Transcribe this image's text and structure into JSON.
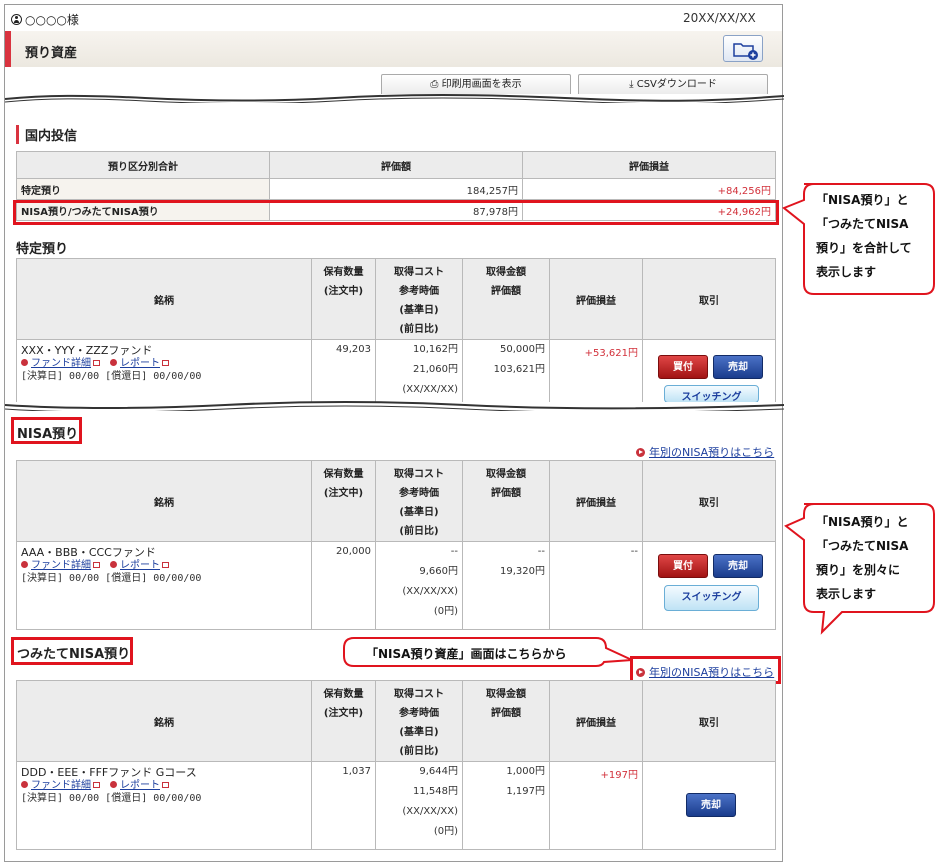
{
  "header": {
    "user": "○○○○様",
    "date": "20XX/XX/XX",
    "title": "預り資産",
    "print_button": "印刷用画面を表示",
    "csv_button": "CSVダウンロード"
  },
  "domestic": {
    "heading": "国内投信",
    "summary_headers": [
      "預り区分別合計",
      "評価額",
      "評価損益"
    ],
    "summary_rows": [
      {
        "label": "特定預り",
        "value": "184,257円",
        "pl": "+84,256円"
      },
      {
        "label": "NISA預り/つみたてNISA預り",
        "value": "87,978円",
        "pl": "+24,962円"
      }
    ]
  },
  "holding_headers": {
    "name": "銘柄",
    "qty": [
      "保有数量",
      "(注文中)"
    ],
    "cost": [
      "取得コスト",
      "参考時価",
      "(基準日)",
      "(前日比)"
    ],
    "amount": [
      "取得金額",
      "評価額"
    ],
    "pl": "評価損益",
    "trade": "取引"
  },
  "tokutei": {
    "heading": "特定預り",
    "fund": "XXX・YYY・ZZZファンド",
    "link_detail": "ファンド詳細",
    "link_report": "レポート",
    "dates": "[決算日] 00/00 [償還日] 00/00/00",
    "qty": "49,203",
    "cost": [
      "10,162円",
      "21,060円",
      "(XX/XX/XX)"
    ],
    "amount": [
      "50,000円",
      "103,621円"
    ],
    "pl": "+53,621円",
    "buy": "買付",
    "sell": "売却",
    "switch": "スイッチング"
  },
  "nisa": {
    "heading": "NISA預り",
    "yearly_link": "年別のNISA預りはこちら",
    "fund": "AAA・BBB・CCCファンド",
    "link_detail": "ファンド詳細",
    "link_report": "レポート",
    "dates": "[決算日] 00/00 [償還日] 00/00/00",
    "qty": "20,000",
    "cost": [
      "--",
      "9,660円",
      "(XX/XX/XX)",
      "(0円)"
    ],
    "amount": [
      "--",
      "19,320円"
    ],
    "pl": "--",
    "buy": "買付",
    "sell": "売却",
    "switch": "スイッチング"
  },
  "tsumitate": {
    "heading": "つみたてNISA預り",
    "yearly_link": "年別のNISA預りはこちら",
    "fund": "DDD・EEE・FFFファンド Gコース",
    "link_detail": "ファンド詳細",
    "link_report": "レポート",
    "dates": "[決算日] 00/00 [償還日] 00/00/00",
    "qty": "1,037",
    "cost": [
      "9,644円",
      "11,548円",
      "(XX/XX/XX)",
      "(0円)"
    ],
    "amount": [
      "1,000円",
      "1,197円"
    ],
    "pl": "+197円",
    "sell": "売却"
  },
  "callouts": {
    "combined": [
      "「NISA預り」と",
      "「つみたてNISA",
      "預り」を合計して",
      "表示します"
    ],
    "separate": [
      "「NISA預り」と",
      "「つみたてNISA",
      "預り」を別々に",
      "表示します"
    ],
    "nisa_screen": "「NISA預り資産」画面はこちらから"
  }
}
